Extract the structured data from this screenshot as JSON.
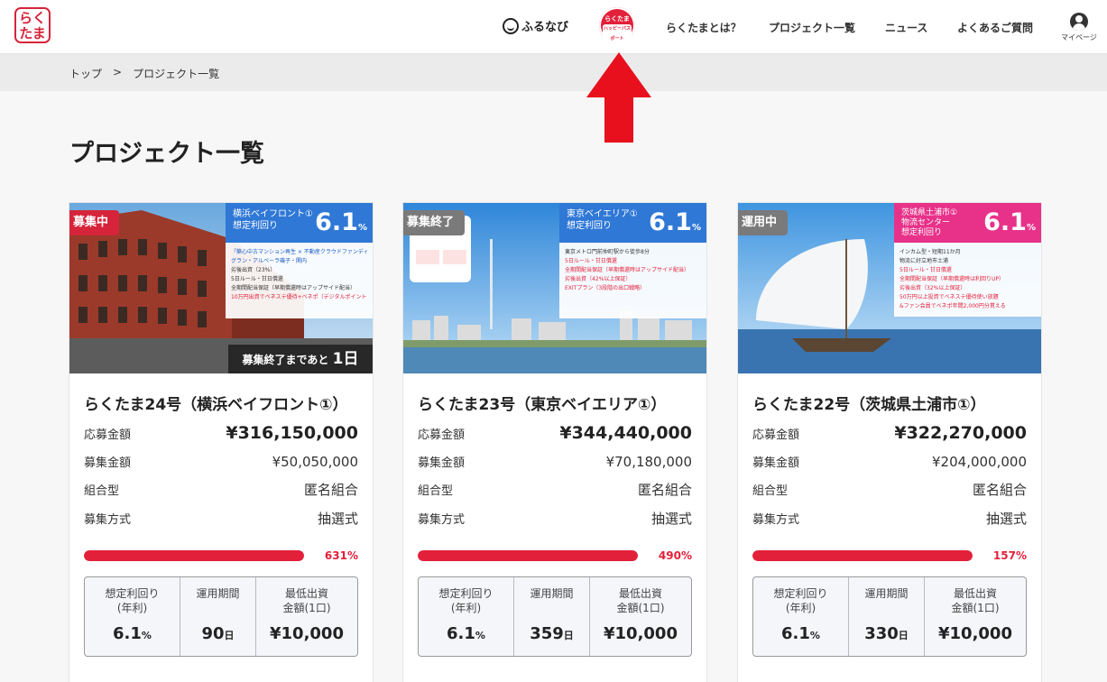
{
  "header": {
    "logo": "らく\nたま",
    "furunavi": "ふるなび",
    "passport": {
      "line1": "らくたま",
      "line2": "ハッピーパスポート"
    },
    "nav": [
      "らくたまとは？",
      "プロジェクト一覧",
      "ニュース",
      "よくあるご質問"
    ],
    "mypage": "マイページ"
  },
  "breadcrumb": {
    "home": "トップ",
    "sep": ">",
    "current": "プロジェクト一覧"
  },
  "page_title": "プロジェクト一覧",
  "colors": {
    "accent": "#e3203a",
    "badge_open": "#d6243a",
    "badge_closed": "#7a7a7a",
    "badge_running": "#7a7a7a",
    "rate_blue": "#2f78d6",
    "rate_pink": "#e8328a"
  },
  "cards": [
    {
      "status": "募集中",
      "rate_label": "横浜ベイフロント①\n想定利回り",
      "rate": "6.1",
      "rate_unit": "%",
      "info_lines": [
        "「築心中古マンション再生 × 不動産クラウドファンディング」",
        "グラン・アルベーラ磯子・関内",
        "劣後出資（23%）",
        "5日ルール・甘日償還",
        "全期間配当保証（早期償還時はアップサイド配当）",
        "10万円出資でベネステ優待+ベネポ（デジタルポイント）"
      ],
      "countdown_prefix": "募集終了まであと",
      "countdown_value": "1日",
      "title": "らくたま24号（横浜ベイフロント①）",
      "applied_label": "応募金額",
      "applied": "¥316,150,000",
      "target_label": "募集金額",
      "target": "¥50,050,000",
      "type_label": "組合型",
      "type": "匿名組合",
      "method_label": "募集方式",
      "method": "抽選式",
      "progress": 100,
      "progress_pct": "631%",
      "stats": [
        {
          "label": "想定利回り\n(年利)",
          "value": "6.1",
          "unit": "%"
        },
        {
          "label": "運用期間",
          "value": "90",
          "unit": "日"
        },
        {
          "label": "最低出資\n金額(1口)",
          "value": "¥10,000",
          "unit": ""
        }
      ]
    },
    {
      "status": "募集終了",
      "rate_label": "東京ベイエリア①\n想定利回り",
      "rate": "6.1",
      "rate_unit": "%",
      "info_lines": [
        "東京メトロ門前仲町駅から徒歩8分",
        "5日ルール・甘日償還",
        "全期間配当保証（早期償還時はアップサイド配当）",
        "劣後出資（42%以上保証）",
        "EXITプラン（3段階の出口戦略）"
      ],
      "countdown_prefix": "",
      "countdown_value": "",
      "title": "らくたま23号（東京ベイエリア①）",
      "applied_label": "応募金額",
      "applied": "¥344,440,000",
      "target_label": "募集金額",
      "target": "¥70,180,000",
      "type_label": "組合型",
      "type": "匿名組合",
      "method_label": "募集方式",
      "method": "抽選式",
      "progress": 100,
      "progress_pct": "490%",
      "stats": [
        {
          "label": "想定利回り\n(年利)",
          "value": "6.1",
          "unit": "%"
        },
        {
          "label": "運用期間",
          "value": "359",
          "unit": "日"
        },
        {
          "label": "最低出資\n金額(1口)",
          "value": "¥10,000",
          "unit": ""
        }
      ]
    },
    {
      "status": "運用中",
      "rate_label": "茨城県土浦市①\n物流センター\n想定利回り",
      "rate": "6.1",
      "rate_unit": "%",
      "info_lines": [
        "インカム型・短期11か月",
        "物流に好立地市土浦",
        "5日ルール・甘日償還",
        "全期間配当保証（早期償還時は利回りUP）",
        "劣後出資（32%以上保証）",
        "50万円以上投資でベネステ優待使い放題",
        "&ファン会員でベネポ年間2,000円分貰える"
      ],
      "countdown_prefix": "",
      "countdown_value": "",
      "title": "らくたま22号（茨城県土浦市①）",
      "applied_label": "応募金額",
      "applied": "¥322,270,000",
      "target_label": "募集金額",
      "target": "¥204,000,000",
      "type_label": "組合型",
      "type": "匿名組合",
      "method_label": "募集方式",
      "method": "抽選式",
      "progress": 100,
      "progress_pct": "157%",
      "stats": [
        {
          "label": "想定利回り\n(年利)",
          "value": "6.1",
          "unit": "%"
        },
        {
          "label": "運用期間",
          "value": "330",
          "unit": "日"
        },
        {
          "label": "最低出資\n金額(1口)",
          "value": "¥10,000",
          "unit": ""
        }
      ]
    }
  ]
}
